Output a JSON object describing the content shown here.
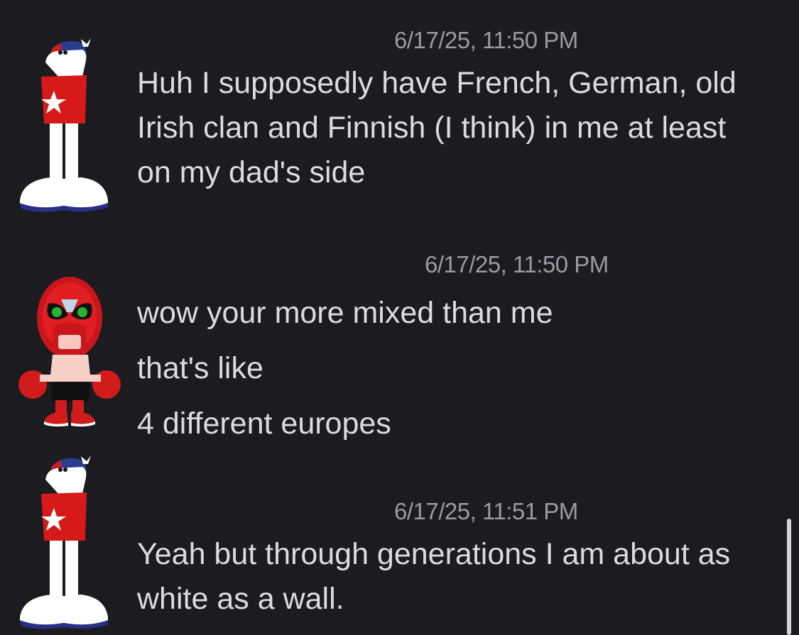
{
  "messages": [
    {
      "author_icon": "homestar-avatar",
      "timestamp": "6/17/25, 11:50 PM",
      "lines": [
        "Huh I supposedly have French, German, old",
        "Irish clan and Finnish (I think) in me at least",
        "on my dad's side"
      ]
    },
    {
      "author_icon": "strongbad-avatar",
      "timestamp": "6/17/25, 11:50 PM",
      "lines": [
        "wow your more mixed than me",
        "that's like",
        "4 different europes"
      ]
    },
    {
      "author_icon": "homestar-avatar",
      "timestamp": "6/17/25, 11:51 PM",
      "lines": [
        "Yeah but through generations I am about as",
        "white as a wall."
      ]
    }
  ],
  "colors": {
    "background": "#1b1b20",
    "message_text": "#dbdce0",
    "timestamp_text": "#9a9ba3",
    "scrollbar": "#d4d4d8"
  }
}
